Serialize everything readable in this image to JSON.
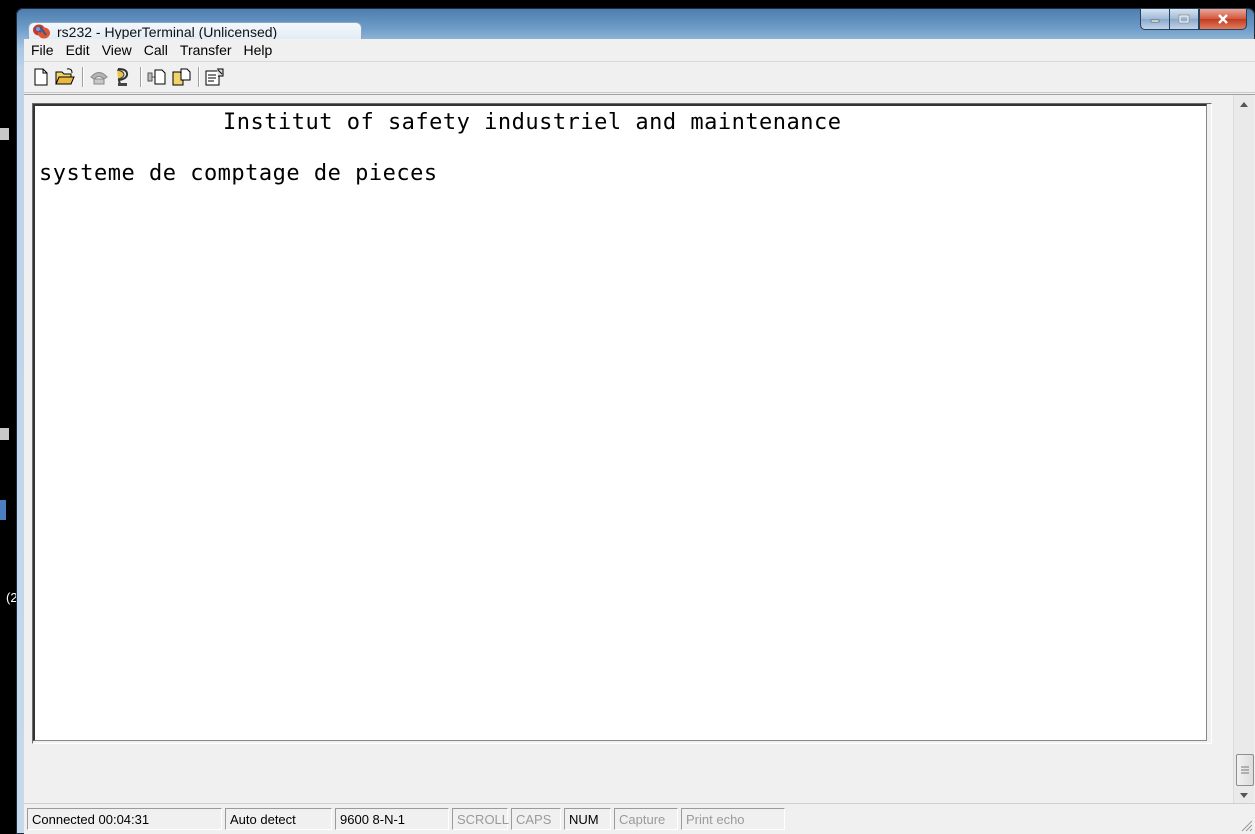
{
  "window": {
    "title": "rs232 - HyperTerminal (Unlicensed)"
  },
  "menu": [
    "File",
    "Edit",
    "View",
    "Call",
    "Transfer",
    "Help"
  ],
  "toolbar": {
    "buttons": [
      "new-connection-icon",
      "open-icon",
      "dial-icon",
      "disconnect-icon",
      "send-icon",
      "receive-icon",
      "properties-icon"
    ]
  },
  "terminal": {
    "lines": [
      "Institut of safety industriel and maintenance",
      "systeme de comptage de pieces"
    ]
  },
  "status": {
    "connected": "Connected 00:04:31",
    "detect": "Auto detect",
    "settings": "9600 8-N-1",
    "scroll": "SCROLL",
    "caps": "CAPS",
    "num": "NUM",
    "capture": "Capture",
    "print_echo": "Print echo"
  },
  "desktop": {
    "edge_text": "(2"
  }
}
